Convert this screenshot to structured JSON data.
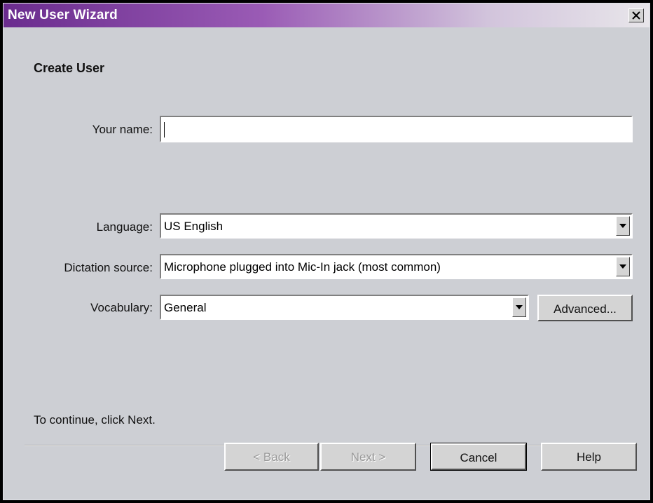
{
  "window": {
    "title": "New User Wizard"
  },
  "page": {
    "heading": "Create User"
  },
  "fields": {
    "name_label": "Your name:",
    "name_value": "",
    "language_label": "Language:",
    "language_value": "US English",
    "dictation_label": "Dictation source:",
    "dictation_value": "Microphone plugged into Mic-In jack (most common)",
    "vocabulary_label": "Vocabulary:",
    "vocabulary_value": "General"
  },
  "buttons": {
    "advanced": "Advanced...",
    "back": "< Back",
    "next": "Next >",
    "cancel": "Cancel",
    "help": "Help"
  },
  "hint": "To continue, click Next.",
  "icons": [
    "close-icon",
    "chevron-down-icon"
  ]
}
